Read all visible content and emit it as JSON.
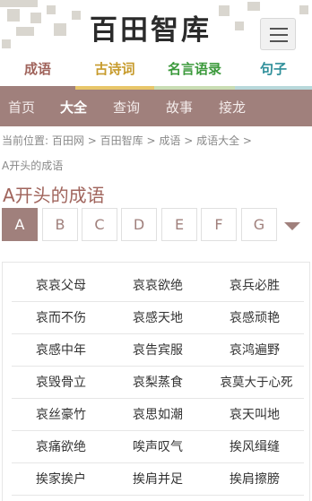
{
  "site": {
    "logo_text": "百田智库"
  },
  "category_tabs": [
    {
      "label": "成语",
      "color": "#a0645c",
      "bar_color": "#a0807c"
    },
    {
      "label": "古诗词",
      "color": "#c79b2c",
      "bar_color": "#e8c66a"
    },
    {
      "label": "名言语录",
      "color": "#3c9a3c",
      "bar_color": "#c9ddb3"
    },
    {
      "label": "句子",
      "color": "#2f8f9a",
      "bar_color": "#b8d8db"
    }
  ],
  "navbar": {
    "items": [
      "首页",
      "大全",
      "查询",
      "故事",
      "接龙"
    ],
    "active": "大全"
  },
  "breadcrumb": {
    "prefix": "当前位置:",
    "path": [
      "百田网",
      "百田智库",
      "成语",
      "成语大全",
      "A开头的成语"
    ],
    "separator": ">"
  },
  "page_title": "A开头的成语",
  "letters": {
    "items": [
      "A",
      "B",
      "C",
      "D",
      "E",
      "F",
      "G"
    ],
    "active": "A",
    "more_icon": "triangle-down-icon"
  },
  "idioms": [
    [
      "哀哀父母",
      "哀哀欲绝",
      "哀兵必胜"
    ],
    [
      "哀而不伤",
      "哀感天地",
      "哀感顽艳"
    ],
    [
      "哀感中年",
      "哀告宾服",
      "哀鸿遍野"
    ],
    [
      "哀毁骨立",
      "哀梨蒸食",
      "哀莫大于心死"
    ],
    [
      "哀丝豪竹",
      "哀思如潮",
      "哀天叫地"
    ],
    [
      "哀痛欲绝",
      "唉声叹气",
      "挨风缉缝"
    ],
    [
      "挨家挨户",
      "挨肩并足",
      "挨肩擦膀"
    ]
  ],
  "colors": {
    "accent": "#a0807c",
    "title": "#a0645c",
    "menu_icon": "menu-icon"
  }
}
